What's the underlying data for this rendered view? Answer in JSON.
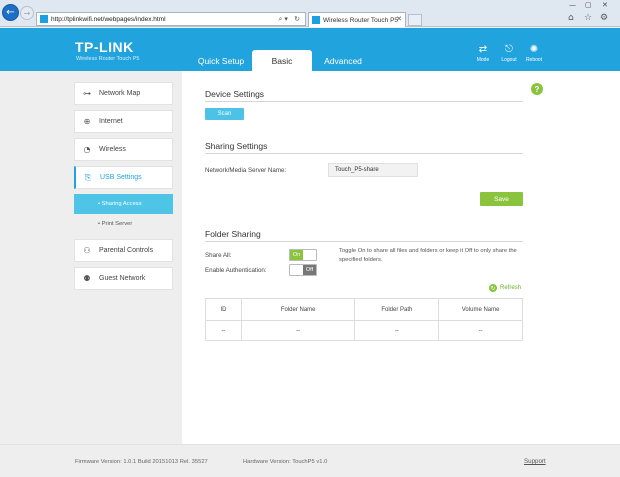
{
  "browser": {
    "url": "http://tplinkwifi.net/webpages/index.html",
    "tab_title": "Wireless Router Touch P5"
  },
  "header": {
    "logo": "TP-LINK",
    "subtitle": "Wireless Router Touch P5",
    "tabs": [
      "Quick Setup",
      "Basic",
      "Advanced"
    ],
    "active_tab": "Basic",
    "buttons": {
      "mode": "Mode",
      "logout": "Logout",
      "reboot": "Reboot"
    }
  },
  "sidebar": {
    "items": [
      {
        "label": "Network Map",
        "icon": "network-map-icon"
      },
      {
        "label": "Internet",
        "icon": "globe-icon"
      },
      {
        "label": "Wireless",
        "icon": "wifi-icon"
      },
      {
        "label": "USB Settings",
        "icon": "usb-icon"
      },
      {
        "label": "Parental Controls",
        "icon": "parental-controls-icon"
      },
      {
        "label": "Guest Network",
        "icon": "guest-network-icon"
      }
    ],
    "active_item": "USB Settings",
    "sub_items": [
      "Sharing Access",
      "Print Server"
    ],
    "active_sub_item": "Sharing Access"
  },
  "device_settings": {
    "title": "Device Settings",
    "scan_label": "Scan"
  },
  "sharing_settings": {
    "title": "Sharing Settings",
    "server_name_label": "Network/Media Server Name:",
    "server_name_value": "Touch_P5-share",
    "save_label": "Save"
  },
  "folder_sharing": {
    "title": "Folder Sharing",
    "share_all_label": "Share All:",
    "share_all_state": "On",
    "auth_label": "Enable Authentication:",
    "auth_state": "Off",
    "toggle_on_label": "On",
    "toggle_off_label": "Off",
    "help_text": "Toggle On to share all files and folders or keep it Off to only share the specified folders.",
    "refresh_label": "Refresh",
    "columns": [
      "ID",
      "Folder Name",
      "Folder Path",
      "Volume Name"
    ],
    "row": [
      "--",
      "--",
      "--",
      "--"
    ]
  },
  "footer": {
    "firmware": "Firmware Version: 1.0.1 Build 20151013 Rel. 35527",
    "hardware": "Hardware Version: TouchP5 v1.0",
    "support": "Support"
  },
  "colors": {
    "brand_blue": "#21a3dd",
    "accent_green": "#8ac43f",
    "light_blue": "#4cc3e6"
  }
}
